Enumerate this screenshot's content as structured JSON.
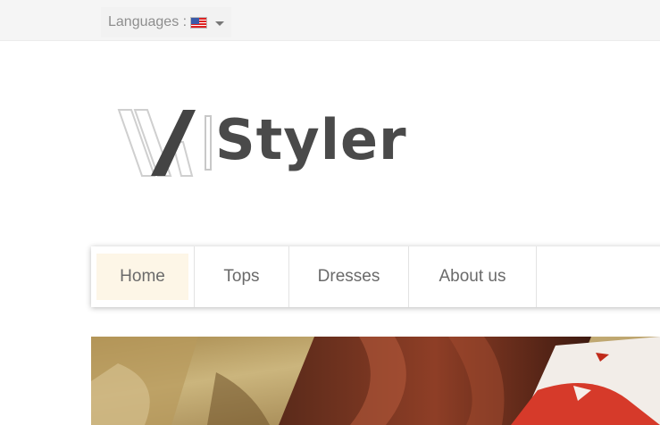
{
  "header": {
    "languages_label": "Languages :",
    "current_language_icon": "us-flag-icon",
    "dropdown_icon": "caret-down-icon"
  },
  "logo": {
    "text": "Styler",
    "mark_icon": "xw-logo-mark"
  },
  "nav": {
    "items": [
      {
        "label": "Home",
        "active": true
      },
      {
        "label": "Tops"
      },
      {
        "label": "Dresses"
      },
      {
        "label": "About us"
      }
    ],
    "active_bg": "#fdf6e7"
  },
  "hero": {
    "description_icon": "hero-banner-image"
  },
  "colors": {
    "topbar_bg": "#f5f5f5",
    "logo_text": "#4a4a4a",
    "nav_text": "#6a6a6a"
  }
}
